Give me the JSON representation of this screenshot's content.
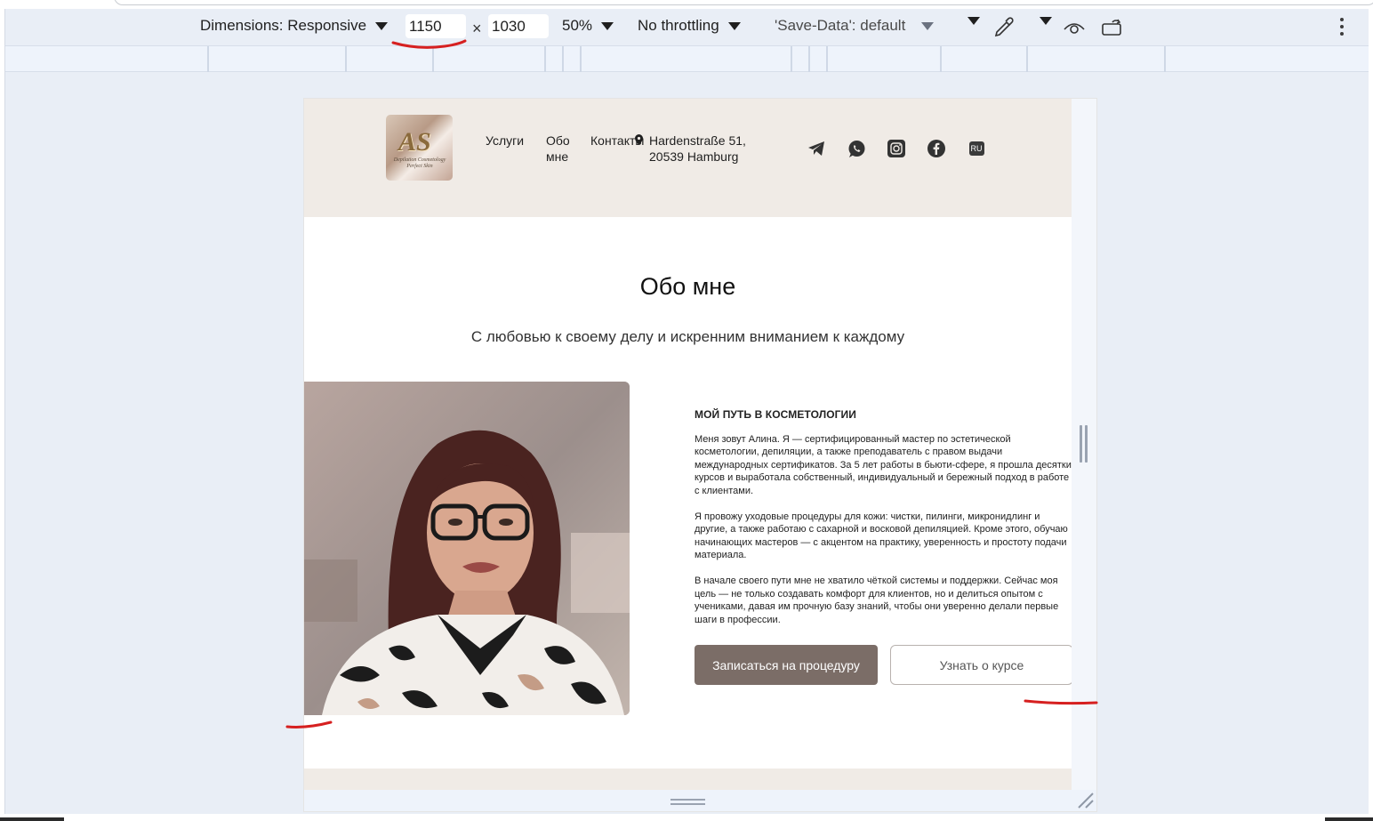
{
  "devtools": {
    "dimensions_label": "Dimensions: Responsive",
    "width_value": "1150",
    "height_value": "1030",
    "times_symbol": "×",
    "zoom": "50%",
    "throttling": "No throttling",
    "save_data": "'Save-Data': default"
  },
  "site": {
    "nav": {
      "services": "Услуги",
      "about_line1": "Обо",
      "about_line2": "мне",
      "contacts": "Контакты"
    },
    "address_line1": "Hardenstraße 51,",
    "address_line2": "20539 Hamburg",
    "lang": "RU",
    "logo": {
      "mark": "AS",
      "subtitle": "Depilation Cosmetology Perfect Skin"
    },
    "about": {
      "title": "Обо мне",
      "subtitle": "С любовью к своему делу и искренним вниманием к каждому",
      "heading": "МОЙ ПУТЬ В КОСМЕТОЛОГИИ",
      "p1": "Меня зовут Алина. Я — сертифицированный мастер по эстетической косметологии, депиляции, а также преподаватель с правом выдачи международных сертификатов. За 5 лет работы в бьюти-сфере, я прошла десятки курсов и выработала собственный, индивидуальный и бережный подход в работе с клиентами.",
      "p2": "Я провожу уходовые процедуры для кожи: чистки, пилинги, микронидлинг и другие, а также работаю с сахарной и восковой депиляцией. Кроме этого, обучаю начинающих мастеров — с акцентом на практику, уверенность и простоту подачи материала.",
      "p3": "В начале своего пути мне не хватило чёткой системы и поддержки. Сейчас моя цель — не только создавать комфорт для клиентов, но и делиться опытом с учениками, давая им прочную базу знаний, чтобы они уверенно делали первые шаги в профессии.",
      "btn_primary": "Записаться на процедуру",
      "btn_secondary": "Узнать о курсе"
    }
  },
  "colors": {
    "header_bg": "#f0ebe6",
    "primary_button": "#7b6d67",
    "annotation_red": "#d62020",
    "devtools_bg": "#e9eef6"
  },
  "icons": [
    "telegram-icon",
    "whatsapp-icon",
    "instagram-icon",
    "facebook-icon",
    "location-pin-icon",
    "eyedropper-icon",
    "eye-icon",
    "rotate-icon",
    "more-vert-icon"
  ]
}
